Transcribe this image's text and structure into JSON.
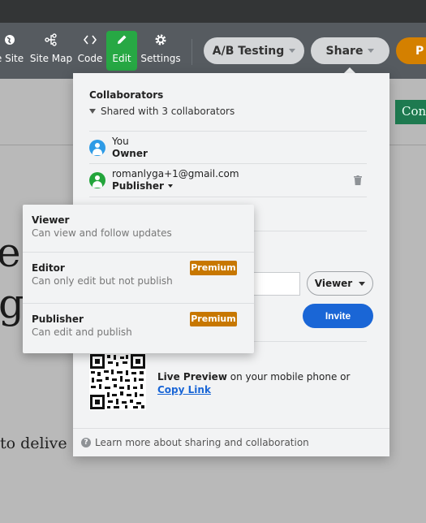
{
  "toolbar": {
    "items": [
      {
        "label": "e Site",
        "icon": "globe-icon"
      },
      {
        "label": "Site Map",
        "icon": "sitemap-icon"
      },
      {
        "label": "Code",
        "icon": "code-icon"
      },
      {
        "label": "Edit",
        "icon": "pencil-icon"
      },
      {
        "label": "Settings",
        "icon": "gear-icon"
      }
    ],
    "ab_testing": "A/B Testing",
    "share": "Share",
    "publish_partial": "P"
  },
  "canvas": {
    "big_text_1": "e",
    "big_text_2": "g",
    "body_text": "to delive",
    "button_partial": "Con"
  },
  "share_panel": {
    "title": "Collaborators",
    "collapse_label": "Shared with 3 collaborators",
    "collaborators": [
      {
        "name": "You",
        "role": "Owner"
      },
      {
        "name": "romanlyga+1@gmail.com",
        "role": "Publisher"
      }
    ],
    "role_select": "Viewer",
    "invite_label": "Invite",
    "live_preview_bold": "Live Preview",
    "live_preview_text": " on your mobile phone or",
    "copy_link": "Copy Link",
    "footer": "Learn more about sharing and collaboration"
  },
  "role_menu": {
    "options": [
      {
        "title": "Viewer",
        "desc": "Can view and follow updates",
        "badge": ""
      },
      {
        "title": "Editor",
        "desc": "Can only edit but not publish",
        "badge": "Premium"
      },
      {
        "title": "Publisher",
        "desc": "Can edit and publish",
        "badge": "Premium"
      }
    ]
  },
  "colors": {
    "accent_green": "#27a844",
    "invite_blue": "#1a66d6",
    "premium_orange": "#c77700",
    "publish_orange": "#d48000"
  }
}
